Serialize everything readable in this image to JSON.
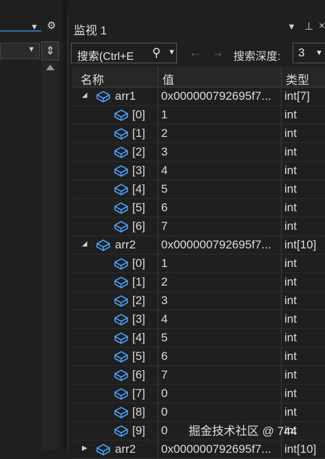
{
  "left_pane": {
    "dropdown_icon": "dropdown-arrow",
    "settings_icon": "gear-icon",
    "split_icon": "split-icon"
  },
  "watch": {
    "title": "监视 1",
    "search_placeholder": "搜索(Ctrl+E",
    "depth_label": "搜索深度:",
    "depth_value": "3",
    "columns": {
      "name": "名称",
      "value": "值",
      "type": "类型"
    },
    "rows": [
      {
        "name": "arr1",
        "value": "0x000000792695f7...",
        "type": "int[7]",
        "expand": "expanded",
        "level": 0
      },
      {
        "name": "[0]",
        "value": "1",
        "type": "int",
        "level": 1
      },
      {
        "name": "[1]",
        "value": "2",
        "type": "int",
        "level": 1
      },
      {
        "name": "[2]",
        "value": "3",
        "type": "int",
        "level": 1
      },
      {
        "name": "[3]",
        "value": "4",
        "type": "int",
        "level": 1
      },
      {
        "name": "[4]",
        "value": "5",
        "type": "int",
        "level": 1
      },
      {
        "name": "[5]",
        "value": "6",
        "type": "int",
        "level": 1
      },
      {
        "name": "[6]",
        "value": "7",
        "type": "int",
        "level": 1
      },
      {
        "name": "arr2",
        "value": "0x000000792695f7...",
        "type": "int[10]",
        "expand": "expanded",
        "level": 0
      },
      {
        "name": "[0]",
        "value": "1",
        "type": "int",
        "level": 1
      },
      {
        "name": "[1]",
        "value": "2",
        "type": "int",
        "level": 1
      },
      {
        "name": "[2]",
        "value": "3",
        "type": "int",
        "level": 1
      },
      {
        "name": "[3]",
        "value": "4",
        "type": "int",
        "level": 1
      },
      {
        "name": "[4]",
        "value": "5",
        "type": "int",
        "level": 1
      },
      {
        "name": "[5]",
        "value": "6",
        "type": "int",
        "level": 1
      },
      {
        "name": "[6]",
        "value": "7",
        "type": "int",
        "level": 1
      },
      {
        "name": "[7]",
        "value": "0",
        "type": "int",
        "level": 1
      },
      {
        "name": "[8]",
        "value": "0",
        "type": "int",
        "level": 1
      },
      {
        "name": "[9]",
        "value": "0",
        "type": "int",
        "level": 1
      },
      {
        "name": "arr2",
        "value": "0x000000792695f7...",
        "type": "int[10]",
        "expand": "collapsed",
        "level": 0
      }
    ]
  },
  "watermark": "掘金技术社区 @ 744",
  "colors": {
    "background": "#1f1f1f",
    "header": "#262626",
    "cube_icon": "#4aa3ff",
    "text": "#dcdcdc"
  }
}
